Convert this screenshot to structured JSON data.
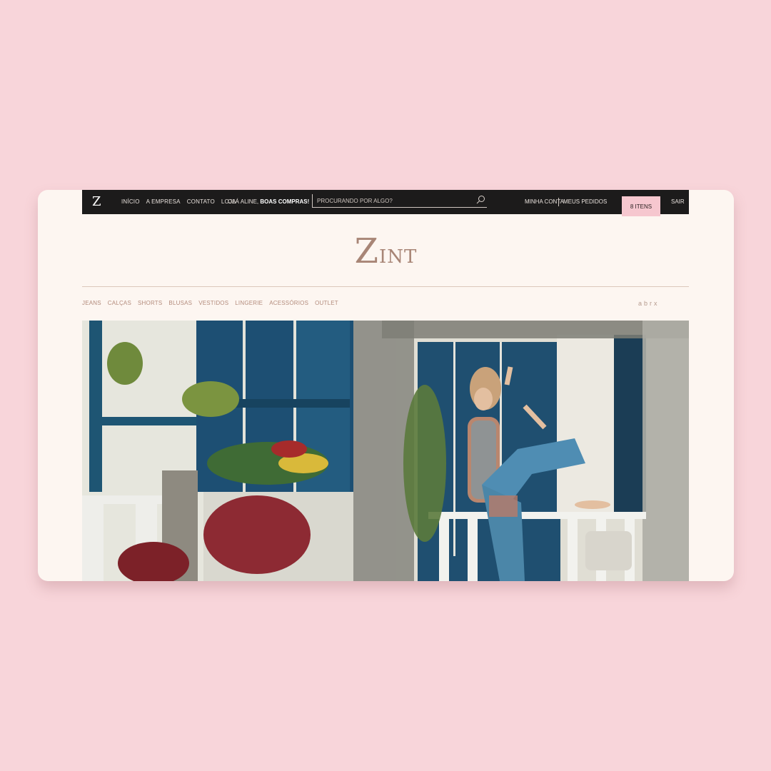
{
  "topbar": {
    "logo": "Z",
    "nav": [
      "INÍCIO",
      "A EMPRESA",
      "CONTATO",
      "LOJA"
    ],
    "greeting_prefix": "OLÁ ALINE,",
    "greeting_bold": "BOAS COMPRAS!",
    "search_placeholder": "PROCURANDO POR ALGO?",
    "search_icon": "search-icon",
    "account": "MINHA CONTA",
    "orders": "MEUS PEDIDOS",
    "cart": "8 ITENS",
    "logout": "SAIR"
  },
  "brand": {
    "initial": "Z",
    "rest": "INT"
  },
  "categories": [
    "JEANS",
    "CALÇAS",
    "SHORTS",
    "BLUSAS",
    "VESTIDOS",
    "LINGERIE",
    "ACESSÓRIOS",
    "OUTLET"
  ],
  "tagline": "abrx",
  "colors": {
    "page_bg": "#f8d5da",
    "card_bg": "#fdf6f1",
    "topbar_bg": "#1c1b1b",
    "cart_bg": "#f6c7cf",
    "brand": "#a88576",
    "category_text": "#b38b7c"
  }
}
